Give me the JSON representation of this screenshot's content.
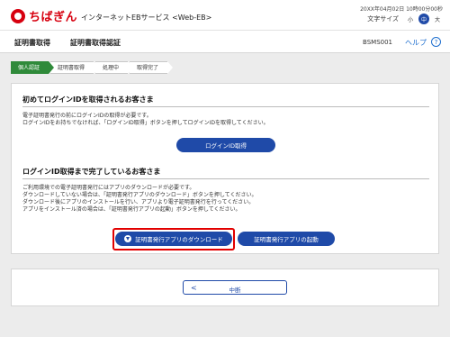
{
  "header": {
    "logo_text": "ちばぎん",
    "service_name": "インターネットEBサービス <Web-EB>",
    "datetime": "20XX年04月02日 10時00分00秒",
    "font_size_label": "文字サイズ",
    "font_small": "小",
    "font_mid": "中",
    "font_large": "大"
  },
  "titlebar": {
    "title1": "証明書取得",
    "title2": "証明書取得認証",
    "screen_id": "BSMS001",
    "help_label": "ヘルプ",
    "help_icon": "?"
  },
  "steps": [
    "個人認証",
    "証明書取得",
    "処理中",
    "取得完了"
  ],
  "section1": {
    "heading": "初めてログインIDを取得されるお客さま",
    "lines": [
      "電子証明書発行の前にログインIDの取得が必要です。",
      "ログインIDをお持ちでなければ、「ログインID取得」ボタンを押してログインIDを取得してください。"
    ],
    "button": "ログインID取得"
  },
  "section2": {
    "heading": "ログインID取得まで完了しているお客さま",
    "lines": [
      "ご利用環境での電子証明書発行にはアプリのダウンロードが必要です。",
      "ダウンロードしていない場合は、「証明書発行アプリのダウンロード」ボタンを押してください。",
      "ダウンロード後にアプリのインストールを行い、アプリより電子証明書発行を行ってください。",
      "アプリをインストール済の場合は、「証明書発行アプリの起動」ボタンを押してください。"
    ],
    "download_button": "証明書発行アプリのダウンロード",
    "launch_button": "証明書発行アプリの起動"
  },
  "footer": {
    "back_button": "中断",
    "back_chevron": "<"
  },
  "colors": {
    "brand_red": "#d7000f",
    "primary_blue": "#1f4aa8",
    "step_active": "#2f8a3a",
    "highlight": "#e20000"
  }
}
